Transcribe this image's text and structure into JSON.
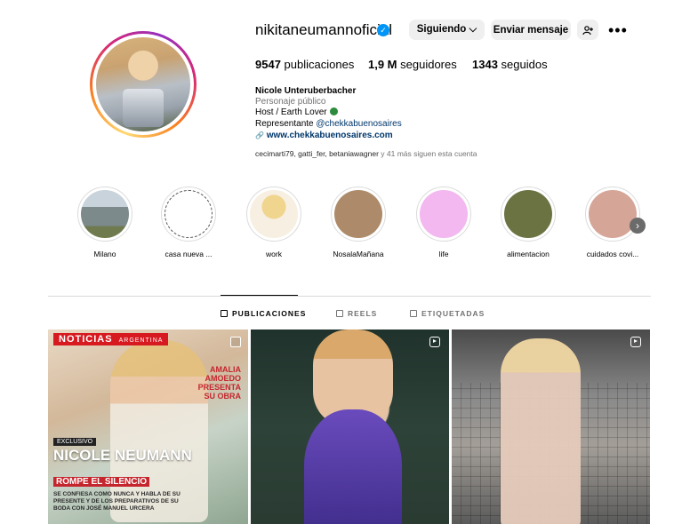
{
  "profile": {
    "username": "nikitaneumannoficial",
    "verified_glyph": "✓",
    "follow_button": "Siguiendo ⌵",
    "message_button": "Enviar mensaje",
    "suggest_glyph": "⁺👤",
    "more_glyph": "•••"
  },
  "stats": {
    "posts_count": "9547",
    "posts_label": "publicaciones",
    "followers_count": "1,9 M",
    "followers_label": "seguidores",
    "following_count": "1343",
    "following_label": "seguidos"
  },
  "bio": {
    "name": "Nicole Unteruberbacher",
    "category": "Personaje público",
    "description": "Host / Earth Lover",
    "representative_prefix": "Representante ",
    "representative_handle": "@chekkabuenosaires",
    "link_glyph": "🔗",
    "link": "www.chekkabuenosaires.com",
    "followed_by_names": "cecimarti79, gatti_fer, betaniawagner",
    "followed_by_rest": " y 41 más siguen esta cuenta"
  },
  "highlights": [
    {
      "label": "Milano",
      "color": "#8fa0a9"
    },
    {
      "label": "casa nueva ...",
      "color": "#ffffff"
    },
    {
      "label": "work",
      "color": "#f3e3bd"
    },
    {
      "label": "NosalaMañana",
      "color": "#ad8b6a"
    },
    {
      "label": "life",
      "color": "#f2b8ef"
    },
    {
      "label": "alimentacion",
      "color": "#6c7343"
    },
    {
      "label": "cuidados covi...",
      "color": "#d5a597"
    }
  ],
  "highlight_next_glyph": "›",
  "tabs": {
    "posts": "PUBLICACIONES",
    "reels": "REELS",
    "tagged": "ETIQUETADAS"
  },
  "posts": {
    "magazine_brand": "NOTICIAS",
    "magazine_country": "ARGENTINA",
    "magazine_side": "AMALIA AMOEDO PRESENTA SU OBRA",
    "magazine_exclusive": "EXCLUSIVO",
    "magazine_headline": "NICOLE NEUMANN",
    "magazine_subhead": "ROMPE EL SILENCIO",
    "magazine_body": "SE CONFIESA COMO NUNCA Y HABLA DE SU PRESENTE Y DE LOS PREPARATIVOS DE SU BODA CON JOSÉ MANUEL URCERA"
  }
}
